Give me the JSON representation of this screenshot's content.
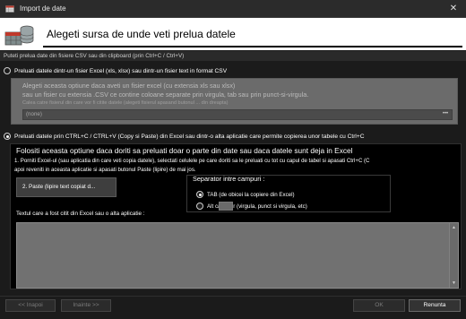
{
  "window": {
    "title": "Import de date",
    "close_glyph": "✕"
  },
  "banner": {
    "heading": "Alegeti sursa de unde veti prelua datele"
  },
  "subtitle": "Puteti prelua date din fisiere CSV sau din clipboard (prin Ctrl+C / Ctrl+V)",
  "option_file": {
    "label": "Preluati datele dintr-un fisier Excel (xls, xlsx) sau dintr-un fisier text in format CSV",
    "selected": false,
    "line1": "Alegeti aceasta optiune daca aveti un fisier excel (cu extensia xls sau xlsx)",
    "line2": "sau un fisier cu extensia .CSV ce contine coloane separate prin virgula, tab sau prin punct-si-virgula.",
    "line3": "Calea catre fisierul din care vor fi citite datele (alegeti fisierul apasand butonul ... din dreapta)",
    "path_value": "(none)",
    "browse_label": "•••"
  },
  "option_clipboard": {
    "label": "Preluati datele prin CTRL+C / CTRL+V (Copy si Paste) din Excel sau dintr-o alta aplicatie care permite copierea unor tabele cu Ctrl+C",
    "selected": true,
    "heading": "Folositi aceasta optiune daca doriti sa preluati doar o parte din date sau daca datele sunt deja in Excel",
    "step1": "1. Porniti Excel-ul (sau aplicatia din care veti copia datele), selectati celulele pe care doriti sa le preluati cu tot cu capul de tabel si apasati Ctrl+C (C",
    "step2": "apoi reveniti in aceasta aplicatie si apasati butonul Paste (lipire) de mai jos.",
    "paste_button": "2. Paste (lipire text copiat d...",
    "separator_group_title": "Separator intre campuri :",
    "separator_tab": "TAB (de obicei la copiere din Excel)",
    "separator_tab_selected": true,
    "separator_other": "Alt caracter (virgula, punct si virgula, etc)",
    "separator_other_selected": false,
    "textarea_label": "Textul care a fost citit din Excel sau o alta aplicatie :",
    "textarea_value": ""
  },
  "footer": {
    "back": "<< Inapoi",
    "next": "Inainte >>",
    "ok": "OK",
    "cancel": "Renunta"
  },
  "icons": {
    "app": "table-import-icon",
    "banner": "database-table-icon",
    "close": "close-icon"
  },
  "colors": {
    "background": "#1b1b1b",
    "banner": "#ffffff",
    "disabled_panel": "#6b6b6b",
    "active_panel": "#000000"
  }
}
